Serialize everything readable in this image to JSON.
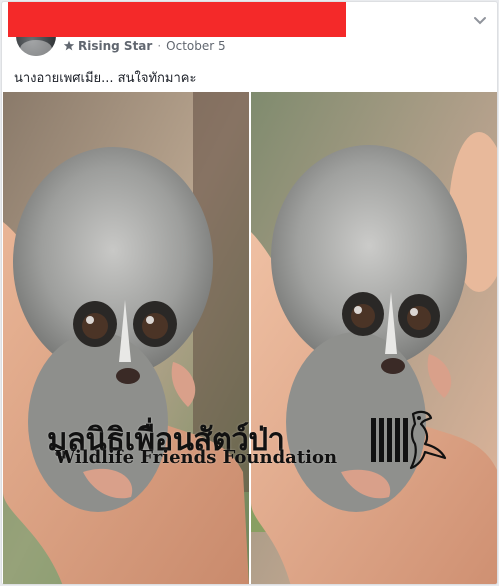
{
  "post": {
    "author_badge": "Rising Star",
    "separator": "·",
    "date": "October 5",
    "caption": "นางอายเพศเมีย... สนใจทักมาคะ"
  },
  "watermark": {
    "thai": "มูลนิธิเพื่อนสัตว์ป่า",
    "english": "Wildlife Friends Foundation"
  },
  "icons": {
    "badge": "star-badge-icon",
    "menu": "chevron-down-icon"
  },
  "colors": {
    "redaction": "#f42929",
    "meta_text": "#616770",
    "caption_text": "#1d2129"
  }
}
